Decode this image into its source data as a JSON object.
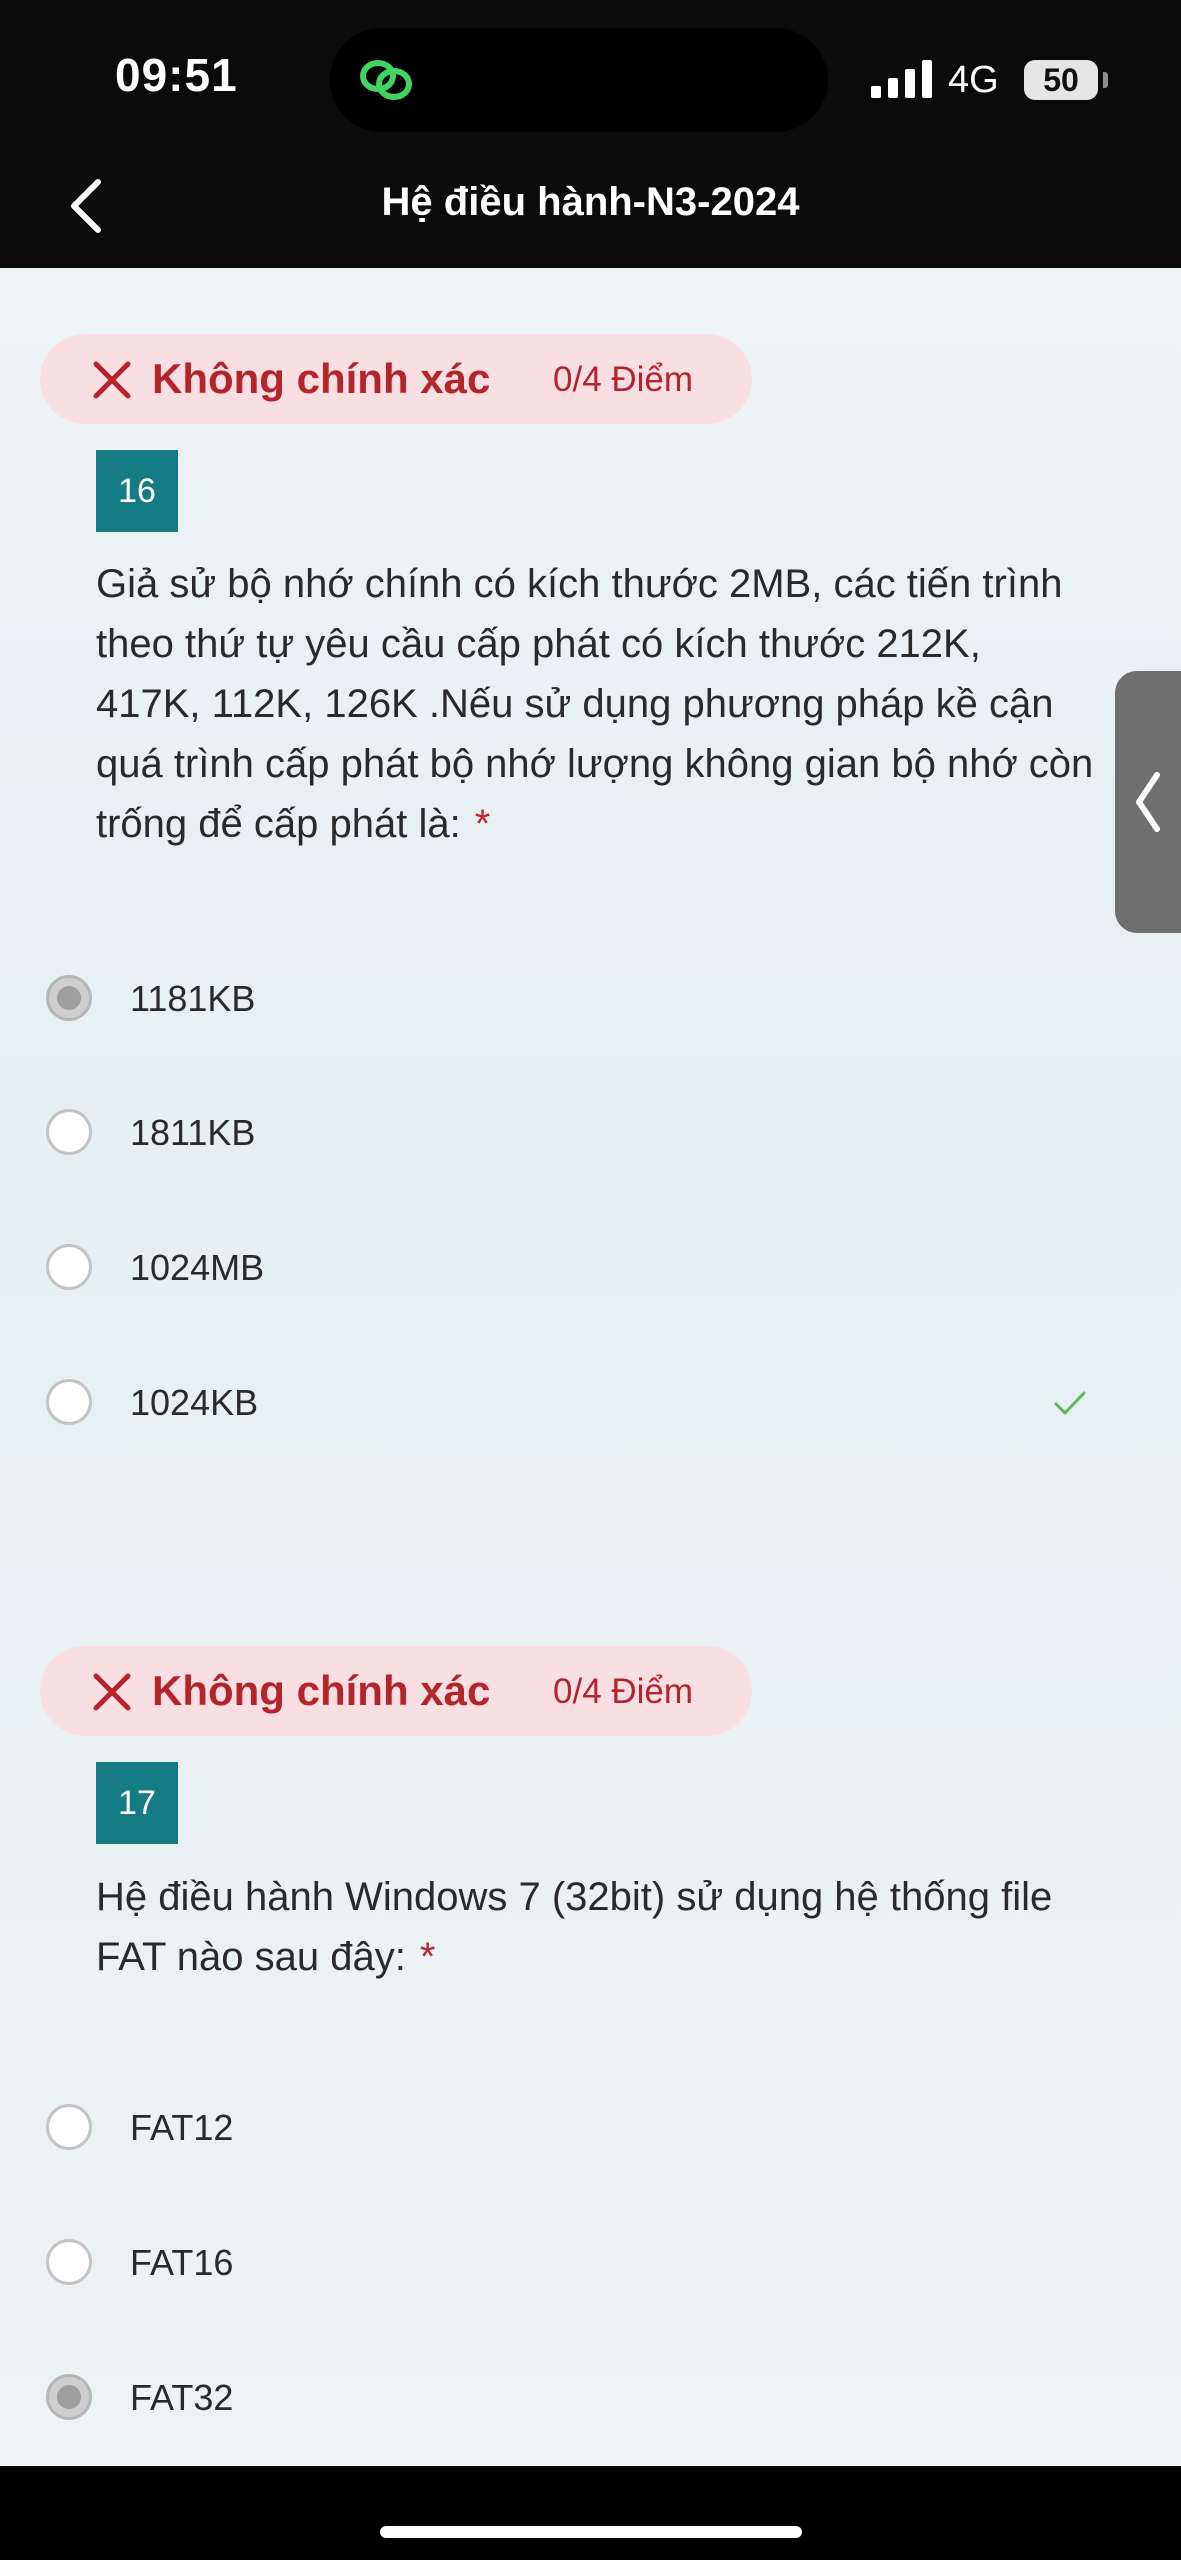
{
  "status_bar": {
    "time": "09:51",
    "network": "4G",
    "battery": "50"
  },
  "header": {
    "title": "Hệ điều hành-N3-2024",
    "back_icon": "chevron-left-icon"
  },
  "colors": {
    "header_bg": "#0b0b0b",
    "badge_bg": "#f9dfe1",
    "badge_text": "#b4242b",
    "question_number_bg": "#157c85",
    "correct_check": "#5cb85c"
  },
  "questions": [
    {
      "status": "Không chính xác",
      "score": "0/4 Điểm",
      "number": "16",
      "text": "Giả sử bộ nhớ chính có kích thước 2MB, các tiến trình theo thứ tự yêu cầu cấp phát có kích thước 212K, 417K, 112K, 126K .Nếu sử dụng phương pháp kề cận quá trình cấp phát bộ nhớ lượng không gian bộ nhớ còn trống để cấp phát là:",
      "required_mark": "*",
      "options": [
        {
          "label": "1181KB",
          "selected": true,
          "correct": false
        },
        {
          "label": "1811KB",
          "selected": false,
          "correct": false
        },
        {
          "label": "1024MB",
          "selected": false,
          "correct": false
        },
        {
          "label": "1024KB",
          "selected": false,
          "correct": true
        }
      ]
    },
    {
      "status": "Không chính xác",
      "score": "0/4 Điểm",
      "number": "17",
      "text": "Hệ điều hành Windows 7 (32bit) sử dụng hệ thống file FAT nào sau đây:",
      "required_mark": "*",
      "options": [
        {
          "label": "FAT12",
          "selected": false,
          "correct": false
        },
        {
          "label": "FAT16",
          "selected": false,
          "correct": false
        },
        {
          "label": "FAT32",
          "selected": true,
          "correct": false
        }
      ]
    }
  ]
}
